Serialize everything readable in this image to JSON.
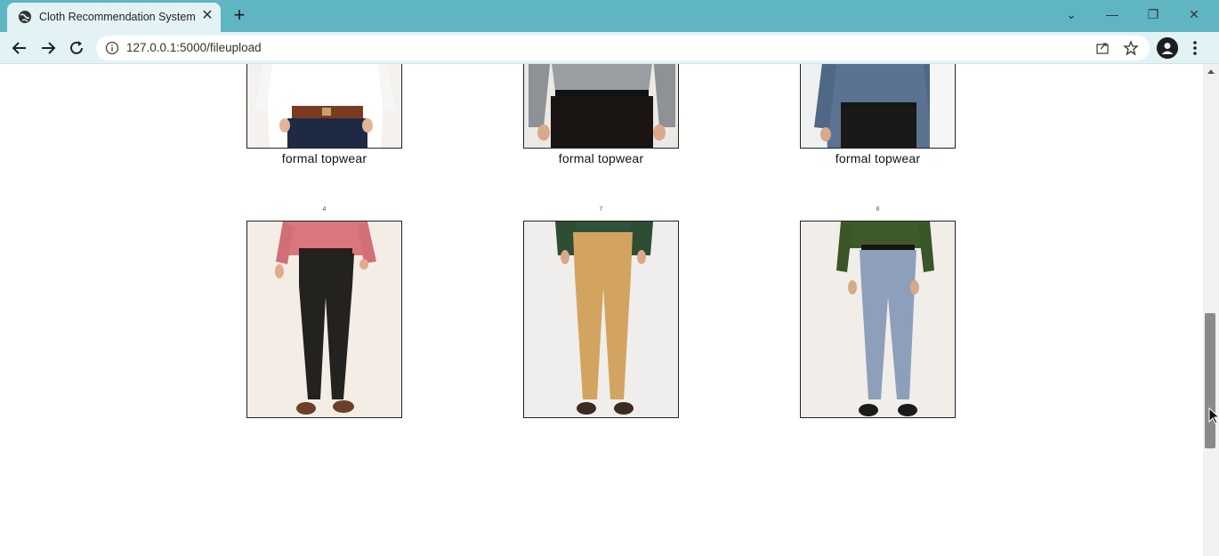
{
  "browser": {
    "tab_title": "Cloth Recommendation System",
    "tab_close": "✕",
    "new_tab": "+",
    "url": "127.0.0.1:5000/fileupload",
    "window_controls": {
      "dropdown": "⌄",
      "minimize": "—",
      "restore": "❐",
      "close": "✕"
    }
  },
  "results": {
    "top_row": [
      {
        "caption": "formal topwear"
      },
      {
        "caption": "formal topwear"
      },
      {
        "caption": "formal topwear"
      }
    ],
    "bottom_row": [
      {
        "index": "4"
      },
      {
        "index": "7"
      },
      {
        "index": "8"
      }
    ]
  },
  "colors": {
    "titlebar": "#5fb5c2",
    "toolbar": "#e3f3f5"
  }
}
